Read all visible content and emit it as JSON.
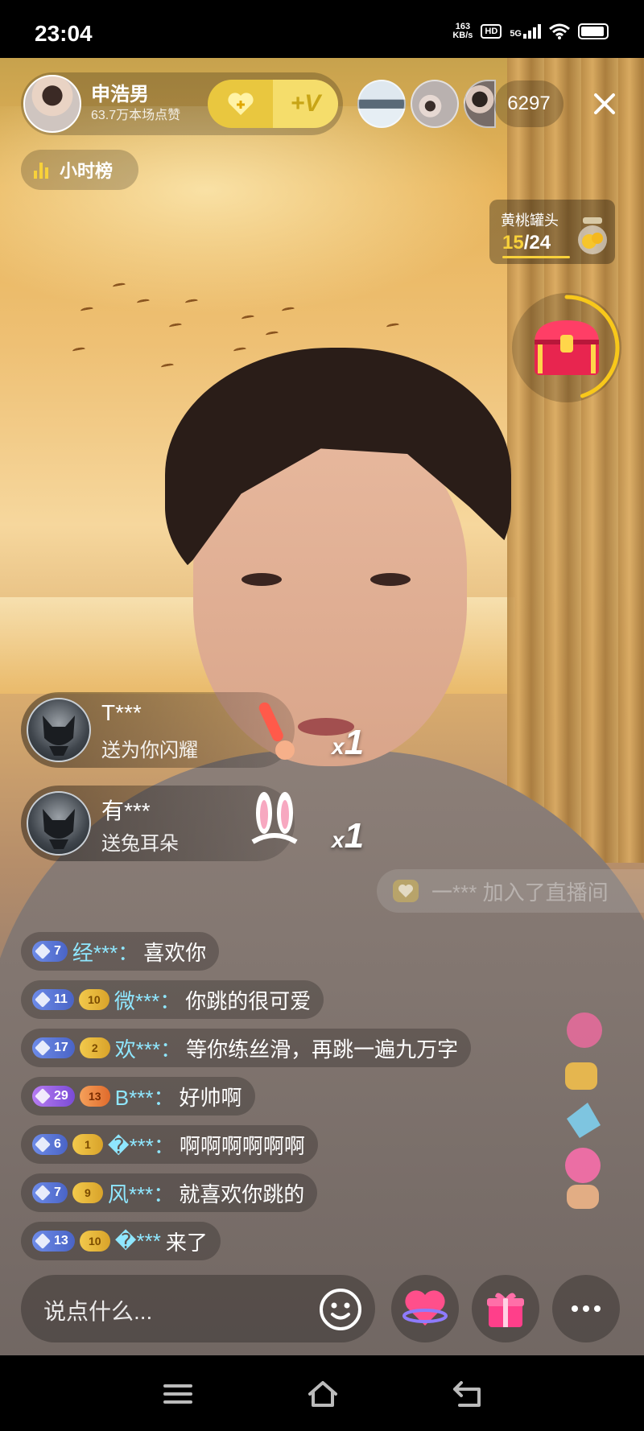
{
  "status_bar": {
    "time": "23:04",
    "net_speed_value": "163",
    "net_speed_unit": "KB/s",
    "hd_label": "HD",
    "network_label": "5G",
    "icons": [
      "signal-bars-icon",
      "wifi-icon",
      "battery-icon"
    ]
  },
  "host": {
    "name": "申浩男",
    "likes": "63.7万本场点赞",
    "follow_left_icon": "heart-plus-icon",
    "follow_right_label": "+V"
  },
  "viewers": {
    "count": "6297",
    "avatars": [
      "viewer-avatar-1",
      "viewer-avatar-2",
      "viewer-avatar-3"
    ]
  },
  "rank_button": {
    "label": "小时榜",
    "icon": "bar-chart-icon"
  },
  "task_card": {
    "title": "黄桃罐头",
    "current": "15",
    "total": "/24",
    "icon": "jar-icon"
  },
  "treasure": {
    "icon": "treasure-chest-icon",
    "progress": 0.45
  },
  "gift_banners": [
    {
      "user": "T***",
      "action": "送为你闪耀",
      "gift_icon": "glow-stick-icon",
      "count": "1",
      "count_prefix": "x"
    },
    {
      "user": "有***",
      "action": "送兔耳朵",
      "gift_icon": "bunny-ears-icon",
      "count": "1",
      "count_prefix": "x"
    }
  ],
  "join_banner": {
    "text": "一*** 加入了直播间"
  },
  "chat": [
    {
      "level": "7",
      "fan": "",
      "user": "经***：",
      "message": "喜欢你"
    },
    {
      "level": "11",
      "fan": "10",
      "user": "微***：",
      "message": "你跳的很可爱"
    },
    {
      "level": "17",
      "fan": "2",
      "user": "欢***：",
      "message": "等你练丝滑，再跳一遍九万字"
    },
    {
      "level": "29",
      "fan": "13",
      "user": "B***：",
      "message": "好帅啊"
    },
    {
      "level": "6",
      "fan": "1",
      "user": "�***：",
      "message": "啊啊啊啊啊啊"
    },
    {
      "level": "7",
      "fan": "9",
      "user": "风***：",
      "message": "就喜欢你跳的"
    },
    {
      "level": "13",
      "fan": "10",
      "user": "�***",
      "message": "来了"
    }
  ],
  "input": {
    "placeholder": "说点什么..."
  },
  "bottom_buttons": [
    "emoji-icon",
    "heart-gift-icon",
    "gift-box-icon",
    "more-icon"
  ],
  "colors": {
    "accent_yellow": "#f8d13a",
    "username_cyan": "#8fe7ff",
    "level_blue": "#5b78d8",
    "level_purple": "#9a60e4",
    "fan_gold": "#e8b83a"
  }
}
